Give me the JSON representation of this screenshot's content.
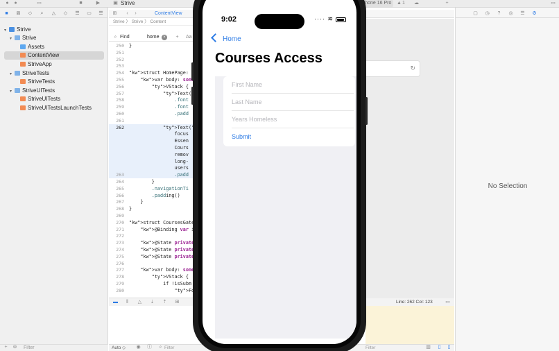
{
  "toolbar": {
    "project_title": "Strive",
    "device_scheme": "iPhone 16 Pro",
    "issues_count": "1"
  },
  "navigator": {
    "items": [
      {
        "label": "Strive",
        "icon": "project-icon",
        "level": 0,
        "disclosure": "open"
      },
      {
        "label": "Strive",
        "icon": "folder-icon",
        "level": 1,
        "disclosure": "open"
      },
      {
        "label": "Assets",
        "icon": "assets-icon",
        "level": 2,
        "disclosure": ""
      },
      {
        "label": "ContentView",
        "icon": "swift-file-icon",
        "level": 2,
        "disclosure": "",
        "selected": true
      },
      {
        "label": "StriveApp",
        "icon": "swift-file-icon",
        "level": 2,
        "disclosure": ""
      },
      {
        "label": "StriveTests",
        "icon": "folder-icon",
        "level": 1,
        "disclosure": "open"
      },
      {
        "label": "StriveTests",
        "icon": "swift-file-icon",
        "level": 2,
        "disclosure": ""
      },
      {
        "label": "StriveUITests",
        "icon": "folder-icon",
        "level": 1,
        "disclosure": "open"
      },
      {
        "label": "StriveUITests",
        "icon": "swift-file-icon",
        "level": 2,
        "disclosure": ""
      },
      {
        "label": "StriveUITestsLaunchTests",
        "icon": "swift-file-icon",
        "level": 2,
        "disclosure": ""
      }
    ],
    "filter_placeholder": "Filter"
  },
  "editor": {
    "tab_label": "ContentView",
    "jumpbar": "Strive 〉 Strive 〉 Content",
    "find": {
      "mode": "Find",
      "query": "home",
      "case_label": "Aa"
    },
    "lines": [
      {
        "n": "250",
        "text": "}"
      },
      {
        "n": "251",
        "text": ""
      },
      {
        "n": "252",
        "text": ""
      },
      {
        "n": "253",
        "text": ""
      },
      {
        "n": "254",
        "text": "struct HomePage: View"
      },
      {
        "n": "255",
        "text": "    var body: some Vi"
      },
      {
        "n": "256",
        "text": "        VStack {"
      },
      {
        "n": "257",
        "text": "            Text(\"Wel"
      },
      {
        "n": "258",
        "text": "                .font"
      },
      {
        "n": "259",
        "text": "                .font"
      },
      {
        "n": "260",
        "text": "                .padd"
      },
      {
        "n": "261",
        "text": ""
      },
      {
        "n": "262",
        "text": "            Text(\"Wel"
      },
      {
        "n": "",
        "text": "                focus"
      },
      {
        "n": "",
        "text": "                Essen"
      },
      {
        "n": "",
        "text": "                Cours"
      },
      {
        "n": "",
        "text": "                remov"
      },
      {
        "n": "",
        "text": "                long-"
      },
      {
        "n": "",
        "text": "                users"
      },
      {
        "n": "263",
        "text": "                .padd"
      },
      {
        "n": "264",
        "text": "        }"
      },
      {
        "n": "265",
        "text": "        .navigationTi"
      },
      {
        "n": "266",
        "text": "        .padding()"
      },
      {
        "n": "267",
        "text": "    }"
      },
      {
        "n": "268",
        "text": "}"
      },
      {
        "n": "269",
        "text": ""
      },
      {
        "n": "270",
        "text": "struct CoursesGatekeep"
      },
      {
        "n": "271",
        "text": "    @Binding var isSub"
      },
      {
        "n": "272",
        "text": ""
      },
      {
        "n": "273",
        "text": "    @State private var"
      },
      {
        "n": "274",
        "text": "    @State private var"
      },
      {
        "n": "275",
        "text": "    @State private var"
      },
      {
        "n": "276",
        "text": ""
      },
      {
        "n": "277",
        "text": "    var body: some Vie"
      },
      {
        "n": "278",
        "text": "        VStack {"
      },
      {
        "n": "279",
        "text": "            if !isSubm"
      },
      {
        "n": "280",
        "text": "                Form"
      }
    ],
    "cursor_position": "Line: 262  Col: 123",
    "console_mode": "Auto ◇",
    "console_filter_placeholder": "Filter",
    "output_filter_placeholder": "Filter"
  },
  "inspector": {
    "empty_label": "No Selection"
  },
  "phone": {
    "time": "9:02",
    "back_label": "Home",
    "nav_title": "Courses Access",
    "form_fields": [
      {
        "placeholder": "First Name"
      },
      {
        "placeholder": "Last Name"
      },
      {
        "placeholder": "Years Homeless"
      }
    ],
    "submit_label": "Submit",
    "accent_color": "#2c7be5"
  }
}
